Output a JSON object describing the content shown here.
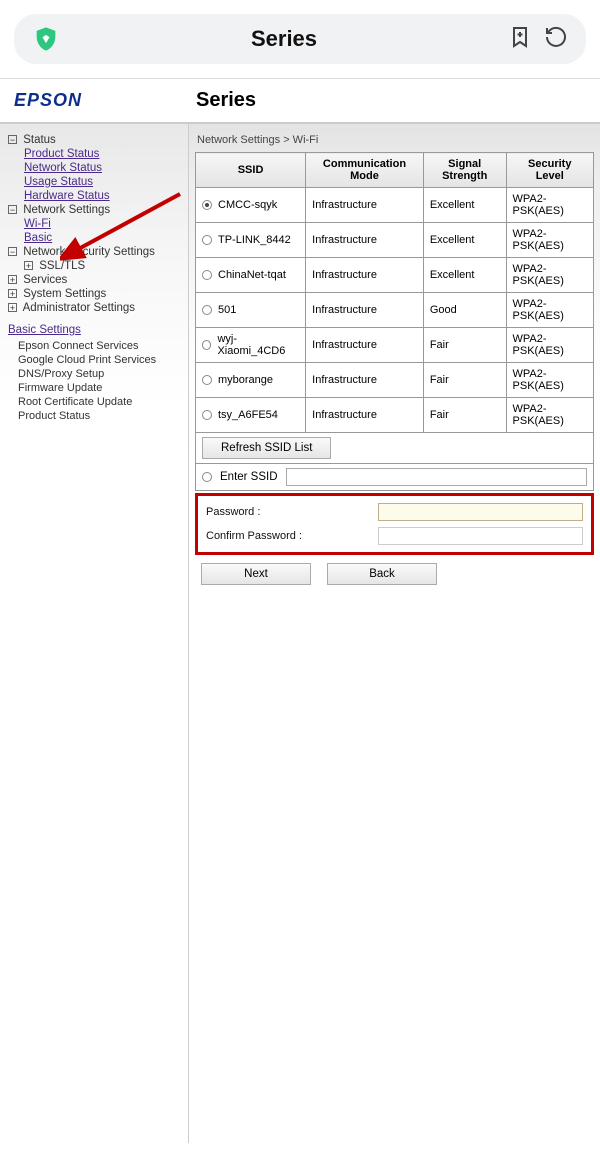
{
  "browser": {
    "title": "Series"
  },
  "header": {
    "logo": "EPSON",
    "page_title": "Series"
  },
  "sidebar": {
    "status": {
      "label": "Status",
      "expanded": "−",
      "items": [
        "Product Status",
        "Network Status",
        "Usage Status",
        "Hardware Status"
      ]
    },
    "network_settings": {
      "label": "Network Settings",
      "expanded": "−",
      "items": [
        "Wi-Fi",
        "Basic"
      ]
    },
    "network_security": {
      "label": "Network Security Settings",
      "expanded": "−",
      "items": [
        {
          "box": "+",
          "label": "SSL/TLS"
        }
      ]
    },
    "services": {
      "box": "+",
      "label": "Services"
    },
    "system": {
      "box": "+",
      "label": "System Settings"
    },
    "admin": {
      "box": "+",
      "label": "Administrator Settings"
    },
    "basic_settings": {
      "label": "Basic Settings",
      "items": [
        "Epson Connect Services",
        "Google Cloud Print Services",
        "DNS/Proxy Setup",
        "Firmware Update",
        "Root Certificate Update",
        "Product Status"
      ]
    }
  },
  "breadcrumb": "Network Settings > Wi-Fi",
  "table": {
    "headers": [
      "SSID",
      "Communication Mode",
      "Signal Strength",
      "Security Level"
    ],
    "rows": [
      {
        "ssid": "CMCC-sqyk",
        "mode": "Infrastructure",
        "signal": "Excellent",
        "sec": "WPA2-PSK(AES)",
        "selected": true
      },
      {
        "ssid": "TP-LINK_8442",
        "mode": "Infrastructure",
        "signal": "Excellent",
        "sec": "WPA2-PSK(AES)",
        "selected": false
      },
      {
        "ssid": "ChinaNet-tqat",
        "mode": "Infrastructure",
        "signal": "Excellent",
        "sec": "WPA2-PSK(AES)",
        "selected": false
      },
      {
        "ssid": "501",
        "mode": "Infrastructure",
        "signal": "Good",
        "sec": "WPA2-PSK(AES)",
        "selected": false
      },
      {
        "ssid": "wyj-Xiaomi_4CD6",
        "mode": "Infrastructure",
        "signal": "Fair",
        "sec": "WPA2-PSK(AES)",
        "selected": false
      },
      {
        "ssid": "myborange",
        "mode": "Infrastructure",
        "signal": "Fair",
        "sec": "WPA2-PSK(AES)",
        "selected": false
      },
      {
        "ssid": "tsy_A6FE54",
        "mode": "Infrastructure",
        "signal": "Fair",
        "sec": "WPA2-PSK(AES)",
        "selected": false
      }
    ]
  },
  "controls": {
    "refresh": "Refresh SSID List",
    "enter_ssid": "Enter SSID",
    "password_label": "Password :",
    "confirm_label": "Confirm Password :",
    "next": "Next",
    "back": "Back"
  }
}
